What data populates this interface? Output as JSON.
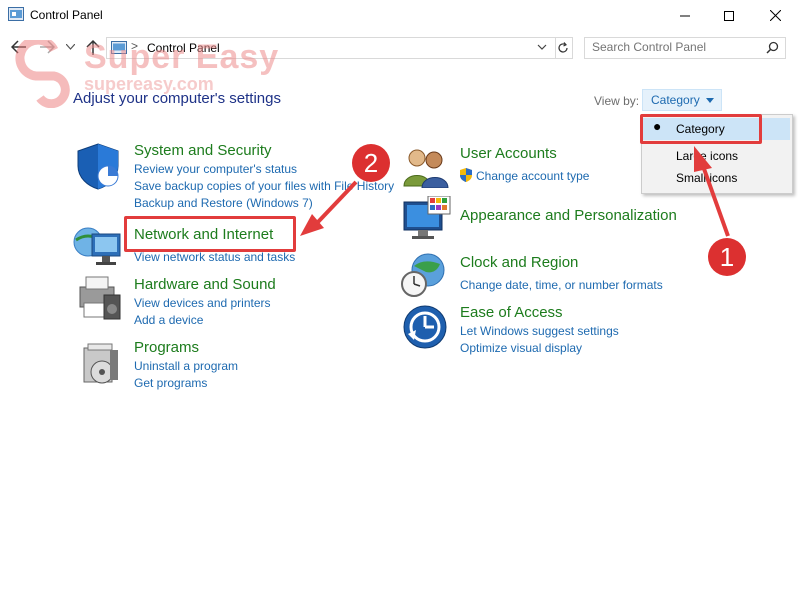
{
  "window": {
    "title": "Control Panel",
    "minimize_icon": "minimize-icon",
    "maximize_icon": "maximize-icon",
    "close_icon": "close-icon"
  },
  "nav": {
    "back_icon": "back-arrow-icon",
    "forward_icon": "forward-arrow-icon",
    "recent_icon": "chevron-down-icon",
    "up_icon": "up-arrow-icon",
    "address_separator": ">",
    "address_text": "Control Panel",
    "refresh_icon": "refresh-icon",
    "search_placeholder": "Search Control Panel"
  },
  "heading": "Adjust your computer's settings",
  "view_by": {
    "label": "View by:",
    "selected": "Category",
    "options": [
      "Category",
      "Large icons",
      "Small icons"
    ]
  },
  "categories_left": [
    {
      "title": "System and Security",
      "links": [
        "Review your computer's status",
        "Save backup copies of your files with File History",
        "Backup and Restore (Windows 7)"
      ],
      "icon": "shield-icon"
    },
    {
      "title": "Network and Internet",
      "links": [
        "View network status and tasks"
      ],
      "icon": "network-globe-icon"
    },
    {
      "title": "Hardware and Sound",
      "links": [
        "View devices and printers",
        "Add a device"
      ],
      "icon": "printer-icon"
    },
    {
      "title": "Programs",
      "links": [
        "Uninstall a program",
        "Get programs"
      ],
      "icon": "programs-box-icon"
    }
  ],
  "categories_right": [
    {
      "title": "User Accounts",
      "links": [
        "Change account type"
      ],
      "icon": "users-icon"
    },
    {
      "title": "Appearance and Personalization",
      "links": [],
      "icon": "monitor-palette-icon"
    },
    {
      "title": "Clock and Region",
      "links": [
        "Change date, time, or number formats"
      ],
      "icon": "clock-globe-icon"
    },
    {
      "title": "Ease of Access",
      "links": [
        "Let Windows suggest settings",
        "Optimize visual display"
      ],
      "icon": "ease-of-access-icon"
    }
  ],
  "annotations": {
    "badge_1": "1",
    "badge_2": "2",
    "watermark_title": "Super Easy",
    "watermark_url": "supereasy.com",
    "annotation_color": "#e23c3c"
  },
  "colors": {
    "category_title": "#1d7c1d",
    "link": "#1e6ab0",
    "heading": "#1e3287"
  }
}
